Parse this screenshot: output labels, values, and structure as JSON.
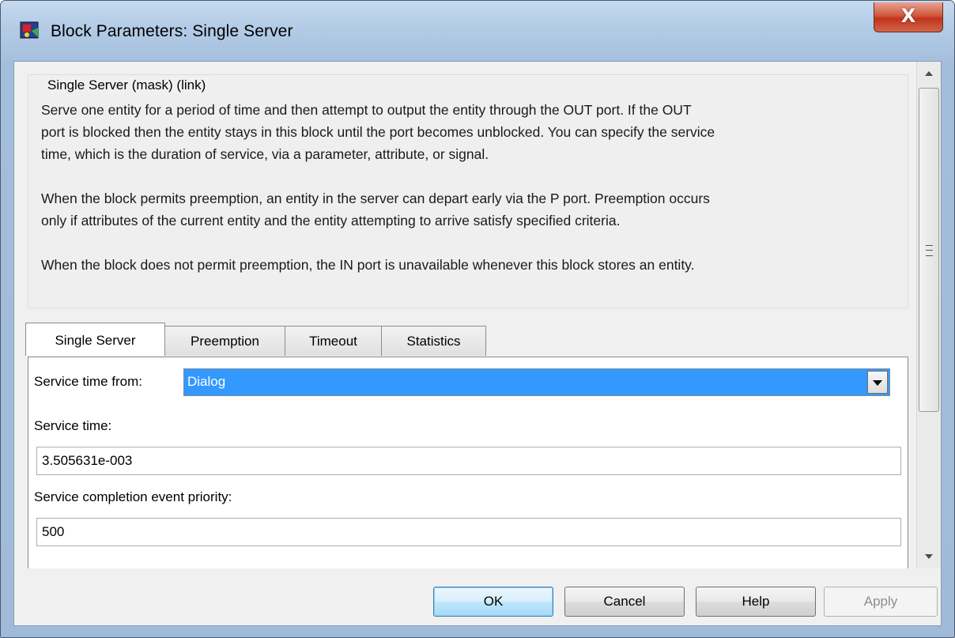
{
  "window": {
    "title": "Block Parameters: Single Server",
    "close_symbol": "X"
  },
  "group": {
    "title": "Single Server (mask) (link)",
    "description_lines": [
      "Serve one entity for a period of time and then attempt to output the entity through the OUT port. If the OUT",
      "port is blocked then the entity stays in this block until the port becomes unblocked. You can specify the service",
      "time, which is the duration of service, via a parameter, attribute, or signal.",
      "When the block permits preemption, an entity in the server can depart early via the P port. Preemption occurs",
      "only if attributes of the current entity and the entity attempting to arrive satisfy specified criteria.",
      "When the block does not permit preemption, the IN port is unavailable whenever this block stores an entity."
    ]
  },
  "tabs": [
    {
      "label": "Single Server",
      "active": true
    },
    {
      "label": "Preemption",
      "active": false
    },
    {
      "label": "Timeout",
      "active": false
    },
    {
      "label": "Statistics",
      "active": false
    }
  ],
  "form": {
    "service_time_from_label": "Service time from:",
    "service_time_from_value": "Dialog",
    "service_time_label": "Service time:",
    "service_time_value": "3.505631e-003",
    "priority_label": "Service completion event priority:",
    "priority_value": "500"
  },
  "buttons": {
    "ok": "OK",
    "cancel": "Cancel",
    "help": "Help",
    "apply": "Apply"
  },
  "colors": {
    "selection": "#3399ff",
    "close_button": "#c0341b"
  }
}
